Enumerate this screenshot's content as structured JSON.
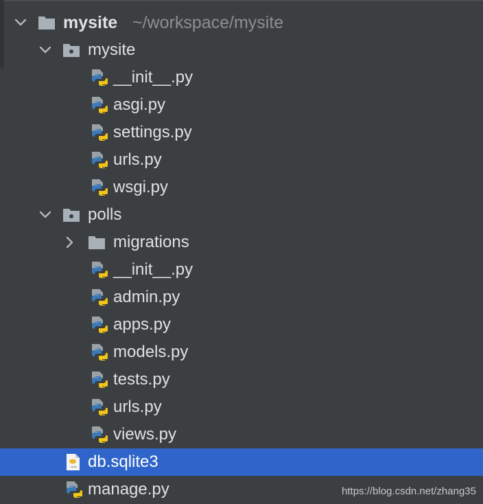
{
  "project": {
    "name": "mysite",
    "path": "~/workspace/mysite"
  },
  "tree": {
    "mysite_pkg": {
      "label": "mysite",
      "files": [
        "__init__.py",
        "asgi.py",
        "settings.py",
        "urls.py",
        "wsgi.py"
      ]
    },
    "polls_pkg": {
      "label": "polls",
      "migrations_label": "migrations",
      "files": [
        "__init__.py",
        "admin.py",
        "apps.py",
        "models.py",
        "tests.py",
        "urls.py",
        "views.py"
      ]
    },
    "db_file": "db.sqlite3",
    "manage_file": "manage.py"
  },
  "selected_item": "db.sqlite3",
  "watermark": "https://blog.csdn.net/zhang35",
  "colors": {
    "background": "#3c3f41",
    "selection": "#2f65ca",
    "text": "#dfe1e5",
    "path_text": "#8c8f93",
    "folder_icon": "#a9b1b8",
    "python_blue": "#3b7ab8",
    "python_yellow": "#f0c419"
  }
}
